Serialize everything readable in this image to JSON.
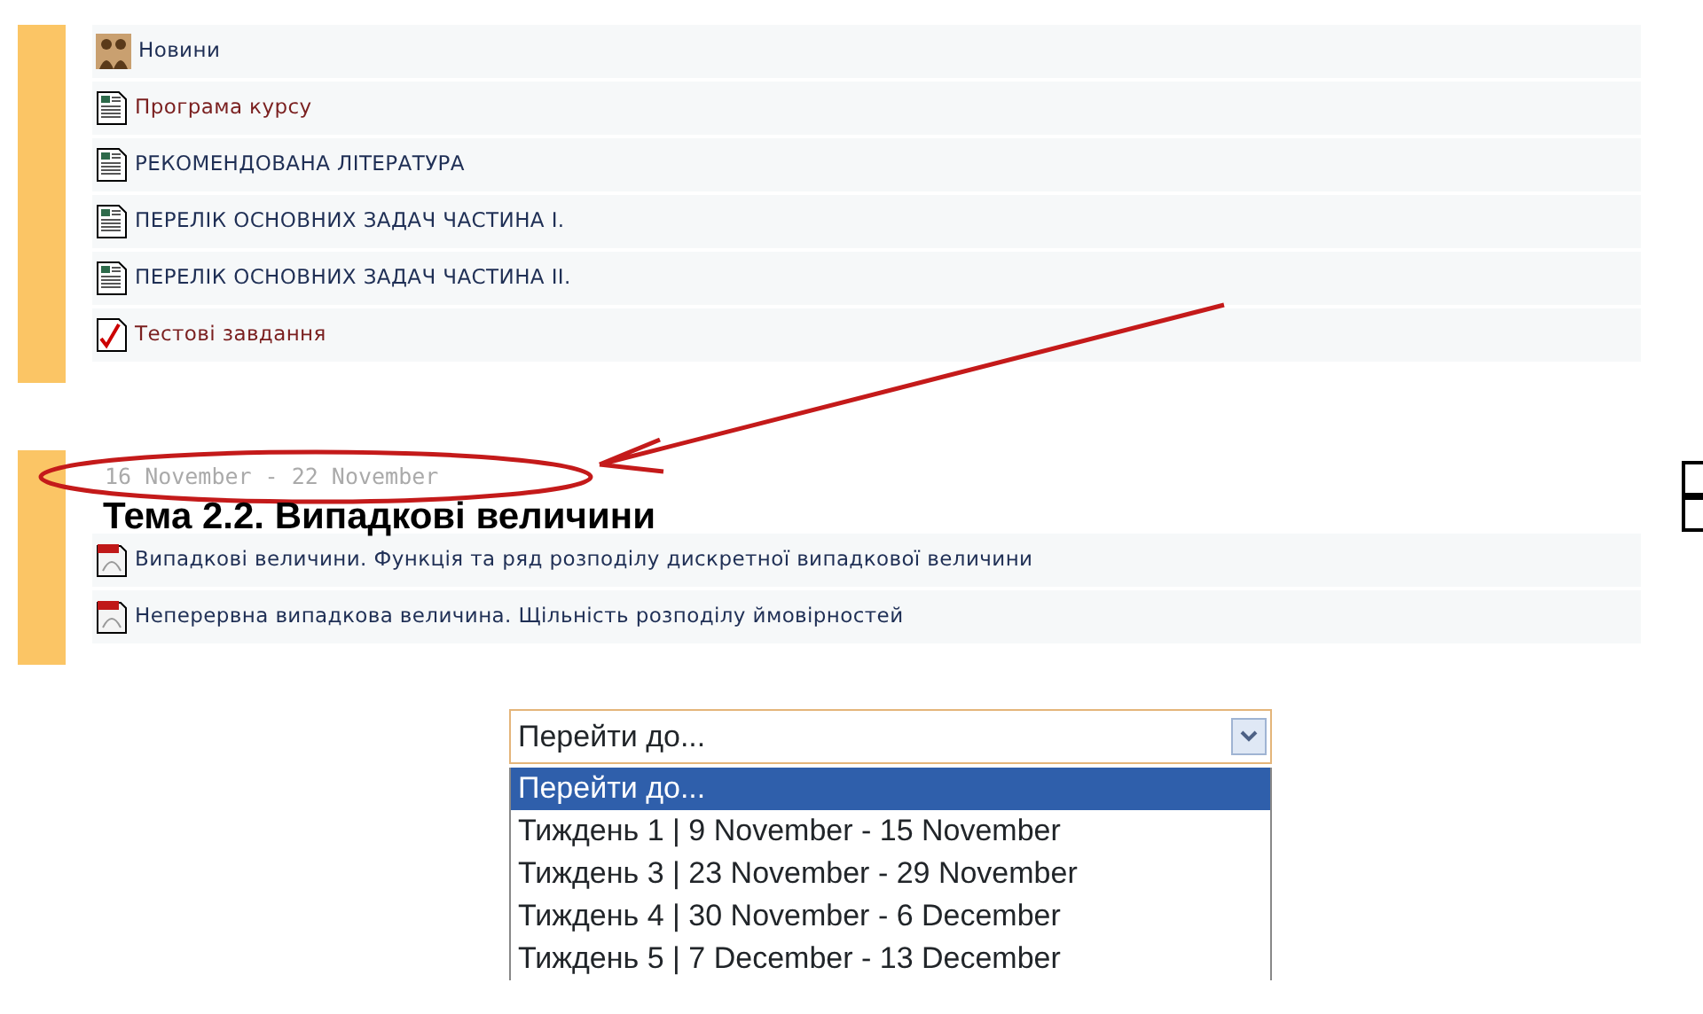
{
  "sections": [
    {
      "items": [
        {
          "kind": "forum",
          "label": "Новини",
          "color": "#1f2f55"
        },
        {
          "kind": "page",
          "label": "Програма курсу",
          "color": "#7a1f1f"
        },
        {
          "kind": "page",
          "label": "РЕКОМЕНДОВАНА ЛІТЕРАТУРА",
          "color": "#1f2f55"
        },
        {
          "kind": "page",
          "label": "ПЕРЕЛІК ОСНОВНИХ ЗАДАЧ ЧАСТИНА I.",
          "color": "#1f2f55"
        },
        {
          "kind": "page",
          "label": "ПЕРЕЛІК ОСНОВНИХ ЗАДАЧ ЧАСТИНА II.",
          "color": "#1f2f55"
        },
        {
          "kind": "quiz",
          "label": "Тестові завдання",
          "color": "#7a1f1f"
        }
      ]
    },
    {
      "date": "16 November - 22 November",
      "title": "Тема 2.2. Випадкові величини",
      "items": [
        {
          "kind": "pdf",
          "label": "Випадкові величини. Функція та ряд розподілу дискретної випадкової величини",
          "color": "#1f2f55"
        },
        {
          "kind": "pdf",
          "label": "Неперервна випадкова величина. Щільність розподілу ймовірностей",
          "color": "#1f2f55"
        }
      ]
    }
  ],
  "jump_menu": {
    "value": "Перейти до...",
    "options": [
      {
        "label": "Перейти до...",
        "selected": true
      },
      {
        "label": "Тиждень 1 | 9 November - 15 November",
        "selected": false
      },
      {
        "label": "Тиждень 3 | 23 November - 29 November",
        "selected": false
      },
      {
        "label": "Тиждень 4 | 30 November - 6 December",
        "selected": false
      },
      {
        "label": "Тиждень 5 | 7 December - 13 December",
        "selected": false
      }
    ]
  }
}
